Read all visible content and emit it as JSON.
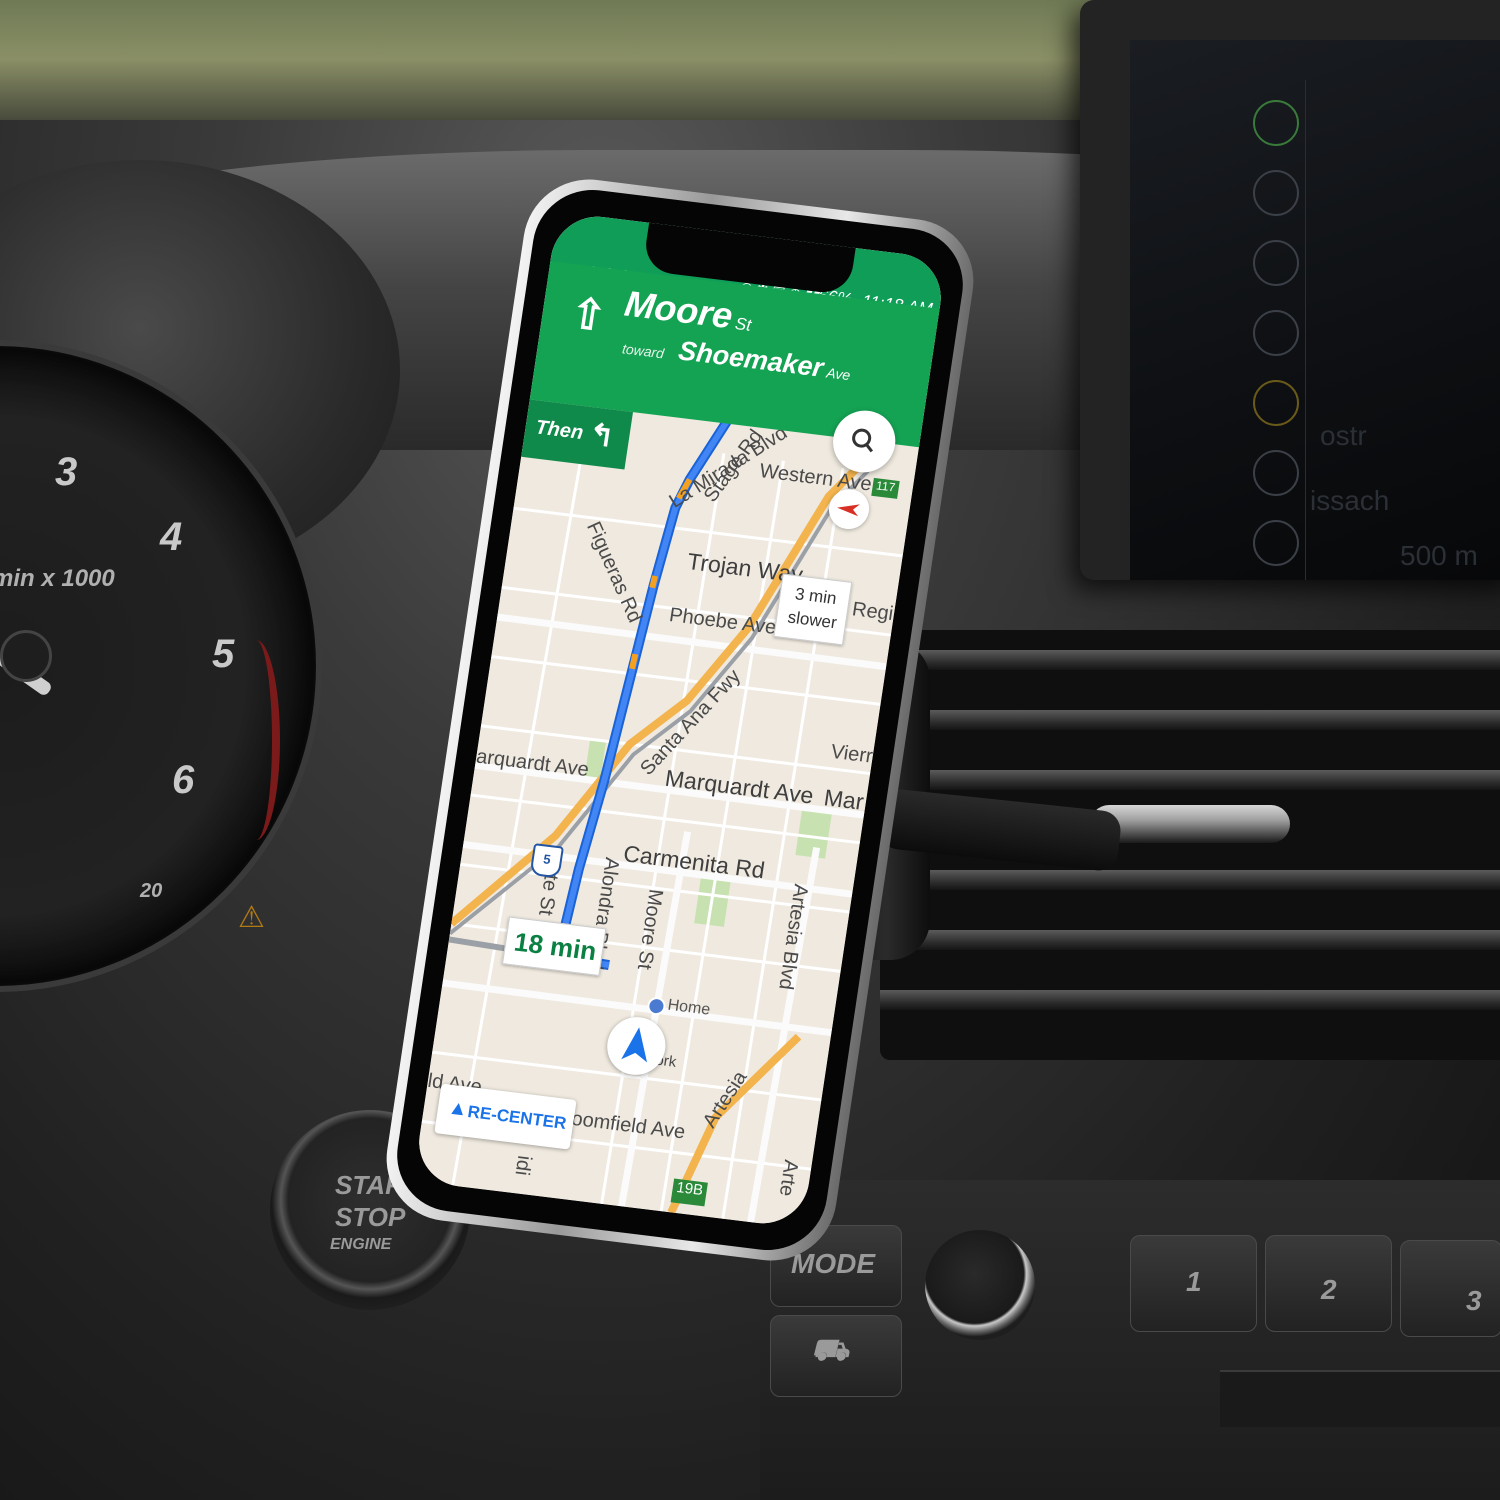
{
  "gauge": {
    "ticks": [
      "3",
      "4",
      "5",
      "6"
    ],
    "unit": "min x 1000",
    "small_tick": "20"
  },
  "console": {
    "mode_label": "MODE",
    "presets": [
      "1",
      "2",
      "3"
    ]
  },
  "start_button": {
    "line1": "START",
    "line2": "STOP",
    "line3": "ENGINE"
  },
  "car_screen": {
    "text1": "500 m",
    "text2": "ostr",
    "text3": "issach"
  },
  "phone": {
    "status": {
      "battery": "66%",
      "time": "11:18 AM"
    },
    "navigation": {
      "direction_icon": "straight-arrow-icon",
      "street": "Moore",
      "street_suffix": "St",
      "toward_label": "toward",
      "toward_street": "Shoemaker",
      "toward_suffix": "Ave",
      "then_label": "Then",
      "then_icon": "turn-left-arrow-icon"
    },
    "map": {
      "labels": {
        "la_mirada": "La Mirada Blvd",
        "stage": "Stage Rd",
        "western": "Western Ave",
        "trojan": "Trojan Way",
        "figueras": "Figueras Rd",
        "phoebe": "Phoebe Ave",
        "regio": "Regio",
        "santa_ana": "Santa Ana Fwy",
        "vierr": "Vierr",
        "marquardt_left": "arquardt Ave",
        "marquardt": "Marquardt Ave",
        "mar": "Mar",
        "carmenita": "Carmenita Rd",
        "ette": "ette St",
        "alondra": "Alondra Blvd",
        "moore": "Moore St",
        "artesia_blvd": "Artesia Blvd",
        "home": "Home",
        "york": "ork",
        "ld_ave": "ld Ave",
        "bloomfield": "Bloomfield Ave",
        "artesia_diag": "Artesia",
        "arte_right": "Arte",
        "idi": "idi"
      },
      "shields": {
        "i5_a": "5",
        "i5_b": "5",
        "route_117": "117",
        "exit_19b": "19B"
      },
      "eta": "18 min",
      "alt_route_line1": "3 min",
      "alt_route_line2": "slower",
      "recenter_label": "RE-CENTER"
    },
    "colors": {
      "header_green": "#14a253",
      "route_blue": "#4285f4",
      "traffic_orange": "#f4a020",
      "map_bg": "#efe9df"
    }
  }
}
